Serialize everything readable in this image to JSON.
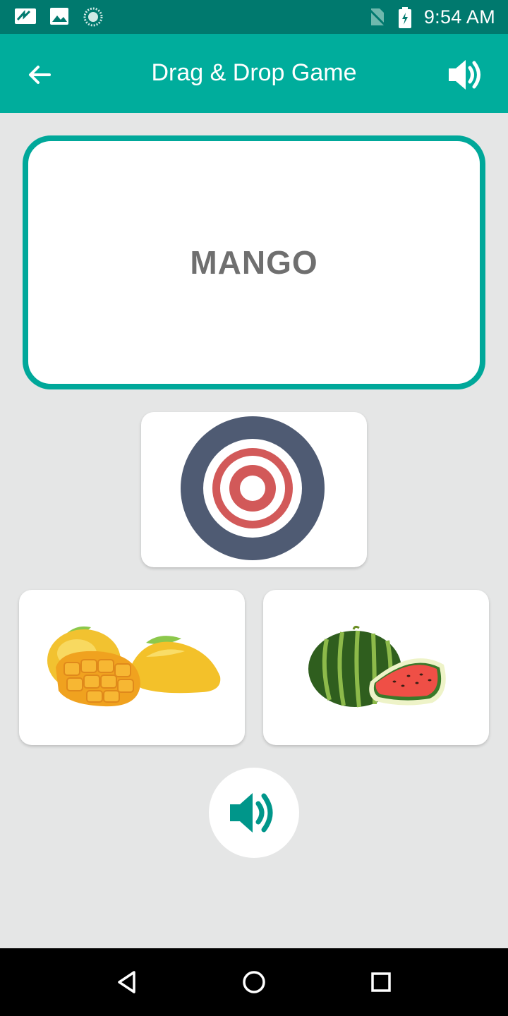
{
  "status_bar": {
    "time": "9:54 AM",
    "icons": [
      "notification-icon",
      "image-icon",
      "loading-icon",
      "no-sim-icon",
      "battery-icon"
    ]
  },
  "app_bar": {
    "title": "Drag & Drop Game",
    "back_icon": "arrow-back-icon",
    "sound_icon": "volume-icon"
  },
  "word_card": {
    "word": "MANGO"
  },
  "drop_target": {
    "icon": "target-icon"
  },
  "options": [
    {
      "name": "mango-image"
    },
    {
      "name": "watermelon-image"
    }
  ],
  "speaker_button": {
    "icon": "volume-icon"
  },
  "nav_bar": {
    "buttons": [
      "back-nav-icon",
      "home-nav-icon",
      "recents-nav-icon"
    ]
  },
  "colors": {
    "status_bar": "#00796e",
    "app_bar": "#00ad9c",
    "accent": "#00a89a",
    "background": "#e5e6e6",
    "word_text": "#6f6f6f"
  }
}
